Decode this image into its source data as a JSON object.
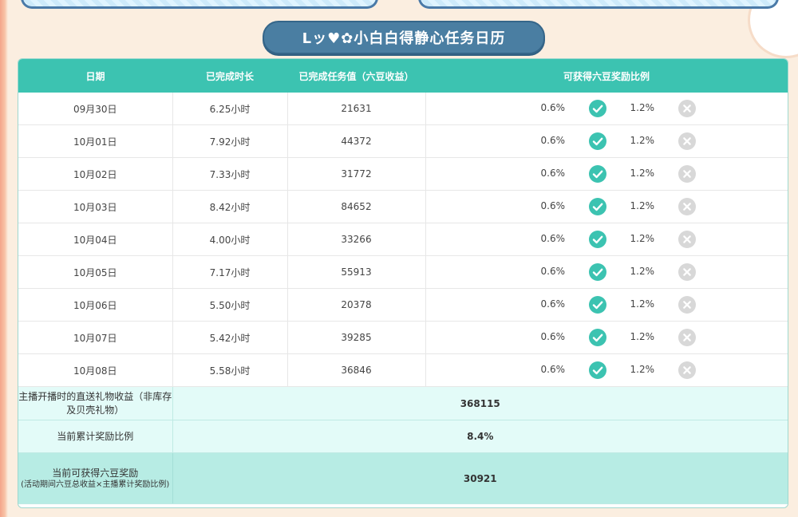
{
  "title": "Lッ♥✿小白白得静心任务日历",
  "columns": {
    "date": "日期",
    "duration": "已完成时长",
    "value": "已完成任务值（六豆收益）",
    "ratio": "可获得六豆奖励比例"
  },
  "rows": [
    {
      "date": "09月30日",
      "duration": "6.25小时",
      "value": "21631",
      "rate1": "0.6%",
      "rate2": "1.2%"
    },
    {
      "date": "10月01日",
      "duration": "7.92小时",
      "value": "44372",
      "rate1": "0.6%",
      "rate2": "1.2%"
    },
    {
      "date": "10月02日",
      "duration": "7.33小时",
      "value": "31772",
      "rate1": "0.6%",
      "rate2": "1.2%"
    },
    {
      "date": "10月03日",
      "duration": "8.42小时",
      "value": "84652",
      "rate1": "0.6%",
      "rate2": "1.2%"
    },
    {
      "date": "10月04日",
      "duration": "4.00小时",
      "value": "33266",
      "rate1": "0.6%",
      "rate2": "1.2%"
    },
    {
      "date": "10月05日",
      "duration": "7.17小时",
      "value": "55913",
      "rate1": "0.6%",
      "rate2": "1.2%"
    },
    {
      "date": "10月06日",
      "duration": "5.50小时",
      "value": "20378",
      "rate1": "0.6%",
      "rate2": "1.2%"
    },
    {
      "date": "10月07日",
      "duration": "5.42小时",
      "value": "39285",
      "rate1": "0.6%",
      "rate2": "1.2%"
    },
    {
      "date": "10月08日",
      "duration": "5.58小时",
      "value": "36846",
      "rate1": "0.6%",
      "rate2": "1.2%"
    }
  ],
  "summary": {
    "gift_label": "主播开播时的直送礼物收益（非库存及贝壳礼物）",
    "gift_value": "368115",
    "ratio_label": "当前累计奖励比例",
    "ratio_value": "8.4%",
    "reward_label": "当前可获得六豆奖励",
    "reward_sub": "(活动期间六豆总收益×主播累计奖励比例)",
    "reward_value": "30921"
  },
  "icons": {
    "achieved": "check-circle-icon",
    "missed": "x-circle-icon"
  },
  "colors": {
    "header": "#3cc3b1",
    "check": "#3cc3b1",
    "x": "#d8d8d8",
    "date_text": "#3aa3b5",
    "title_pill": "#4a7ea2",
    "summary_bg": "#e3fbf8",
    "summary_bg_final": "#b7ece4"
  }
}
